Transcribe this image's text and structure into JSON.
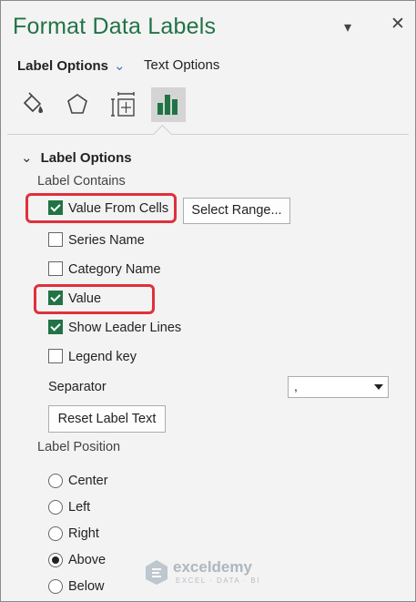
{
  "pane": {
    "title": "Format Data Labels",
    "dropdown_glyph": "▾",
    "close_glyph": "✕"
  },
  "tabs": {
    "main_label": "Label Options",
    "main_chevron": "⌄",
    "text_label": "Text Options"
  },
  "icons": [
    "fill-line-icon",
    "effects-icon",
    "size-properties-icon",
    "label-options-icon"
  ],
  "section": {
    "chevron": "⌄",
    "title": "Label Options"
  },
  "label_contains": {
    "heading": "Label Contains",
    "options": [
      {
        "label": "Value From Cells",
        "checked": true
      },
      {
        "label": "Series Name",
        "checked": false
      },
      {
        "label": "Category Name",
        "checked": false
      },
      {
        "label": "Value",
        "checked": true
      },
      {
        "label": "Show Leader Lines",
        "checked": true
      },
      {
        "label": "Legend key",
        "checked": false
      }
    ],
    "select_range_label": "Select Range..."
  },
  "separator": {
    "label": "Separator",
    "value": ","
  },
  "reset_label": "Reset Label Text",
  "label_position": {
    "heading": "Label Position",
    "options": [
      {
        "label": "Center",
        "selected": false
      },
      {
        "label": "Left",
        "selected": false
      },
      {
        "label": "Right",
        "selected": false
      },
      {
        "label": "Above",
        "selected": true
      },
      {
        "label": "Below",
        "selected": false
      }
    ]
  },
  "watermark": {
    "name": "exceldemy",
    "tagline": "EXCEL · DATA · BI"
  },
  "colors": {
    "accent": "#217346",
    "highlight": "#e0303c"
  }
}
